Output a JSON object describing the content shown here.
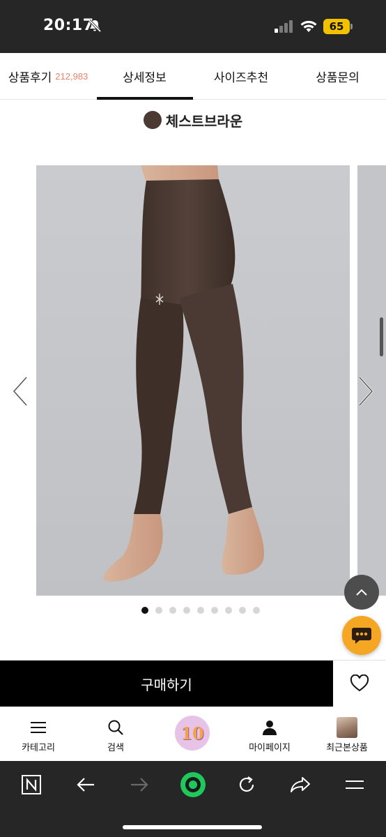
{
  "status_bar": {
    "time": "20:17",
    "battery_level": "65",
    "icons": [
      "bell-slash-icon",
      "signal-icon",
      "wifi-icon",
      "battery-icon"
    ]
  },
  "tabs": [
    {
      "label": "상품후기",
      "count": "212,983"
    },
    {
      "label": "상세정보",
      "active": true
    },
    {
      "label": "사이즈추천"
    },
    {
      "label": "상품문의"
    }
  ],
  "color_option": {
    "name": "체스트브라운",
    "swatch": "#4a3a32"
  },
  "carousel": {
    "total_pages": 9,
    "current_page": 1
  },
  "buy_bar": {
    "buy_label": "구매하기"
  },
  "bottom_nav": [
    {
      "label": "카테고리",
      "icon": "menu-icon"
    },
    {
      "label": "검색",
      "icon": "search-icon"
    },
    {
      "label": "10",
      "icon": "promo-badge"
    },
    {
      "label": "마이페이지",
      "icon": "person-icon"
    },
    {
      "label": "최근본상품",
      "icon": "recent-product-thumbnail"
    }
  ],
  "browser_bar": {
    "icons": [
      "naver-n-icon",
      "back-arrow-icon",
      "forward-arrow-icon",
      "green-home-icon",
      "reload-icon",
      "share-icon",
      "menu-icon"
    ]
  },
  "colors": {
    "accent_count": "#e8836b",
    "chat_button": "#f5a623",
    "buy_button": "#000000"
  }
}
